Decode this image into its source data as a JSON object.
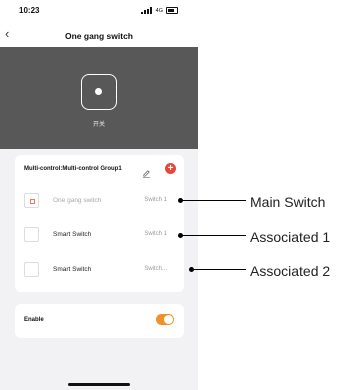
{
  "status_bar": {
    "time": "10:23",
    "network": "4G"
  },
  "nav": {
    "back_icon": "chevron-left-icon",
    "title": "One gang switch"
  },
  "hero": {
    "switch_label": "开关"
  },
  "group": {
    "title": "Multi-control:Multi-control Group1",
    "devices": [
      {
        "name": "One gang switch",
        "channel": "Switch 1",
        "dimmed": true
      },
      {
        "name": "Smart Switch",
        "channel": "Switch 1",
        "dimmed": false
      },
      {
        "name": "Smart Switch",
        "channel": "Switch...",
        "dimmed": false
      }
    ]
  },
  "enable": {
    "label": "Enable",
    "on": true
  },
  "callouts": [
    "Main Switch",
    "Associated 1",
    "Associated 2"
  ],
  "colors": {
    "accent": "#f0922a",
    "add": "#e5483b",
    "hero": "#585858"
  }
}
